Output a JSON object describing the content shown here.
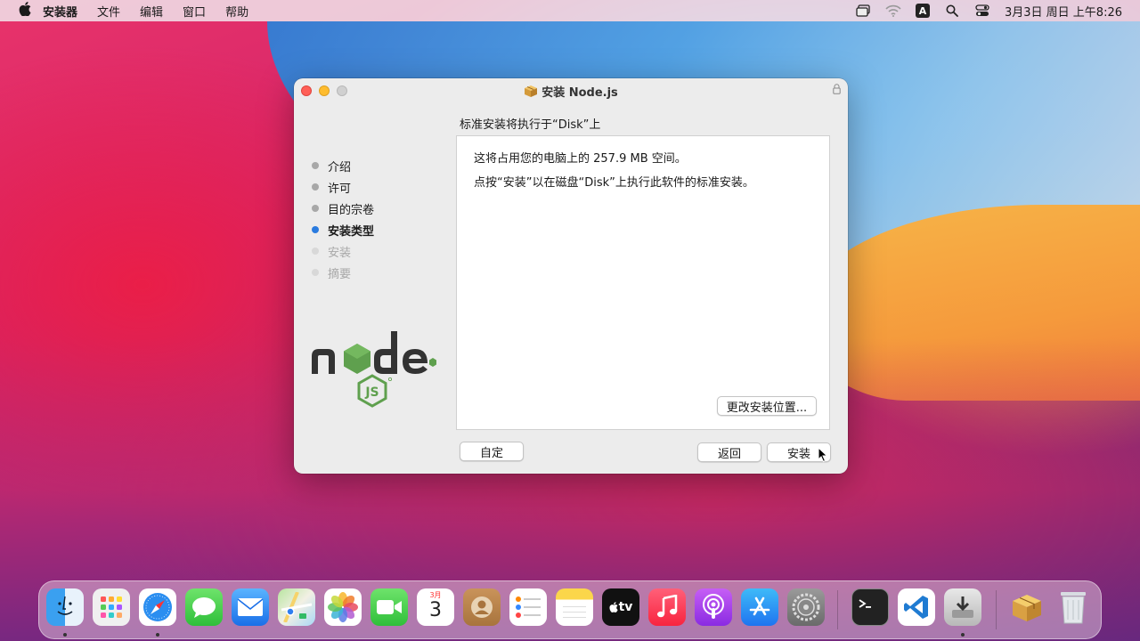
{
  "menubar": {
    "app_name": "安装器",
    "menus": [
      "文件",
      "编辑",
      "窗口",
      "帮助"
    ],
    "input_method": "A",
    "clock": "3月3日 周日 上午8:26"
  },
  "window": {
    "title": "安装 Node.js",
    "steps": [
      {
        "label": "介绍",
        "state": "done"
      },
      {
        "label": "许可",
        "state": "done"
      },
      {
        "label": "目的宗卷",
        "state": "done"
      },
      {
        "label": "安装类型",
        "state": "active"
      },
      {
        "label": "安装",
        "state": "future"
      },
      {
        "label": "摘要",
        "state": "future"
      }
    ],
    "heading": "标准安装将执行于“Disk”上",
    "line1": "这将占用您的电脑上的 257.9 MB 空间。",
    "line2": "点按“安装”以在磁盘“Disk”上执行此软件的标准安装。",
    "change_location_label": "更改安装位置...",
    "customize_label": "自定",
    "back_label": "返回",
    "install_label": "安装",
    "accent_color": "#2a7bdf"
  },
  "dock": {
    "calendar_month": "3月",
    "calendar_day": "3",
    "tv_label": "tv",
    "apps": [
      "finder-icon",
      "launchpad-icon",
      "safari-icon",
      "messages-icon",
      "mail-icon",
      "maps-icon",
      "photos-icon",
      "facetime-icon",
      "calendar-icon",
      "contacts-icon",
      "reminders-icon",
      "notes-icon",
      "appletv-icon",
      "music-icon",
      "podcasts-icon",
      "appstore-icon",
      "system-preferences-icon",
      "terminal-icon",
      "vscode-icon",
      "installer-disk-icon",
      "installer-package-icon",
      "trash-icon"
    ]
  }
}
